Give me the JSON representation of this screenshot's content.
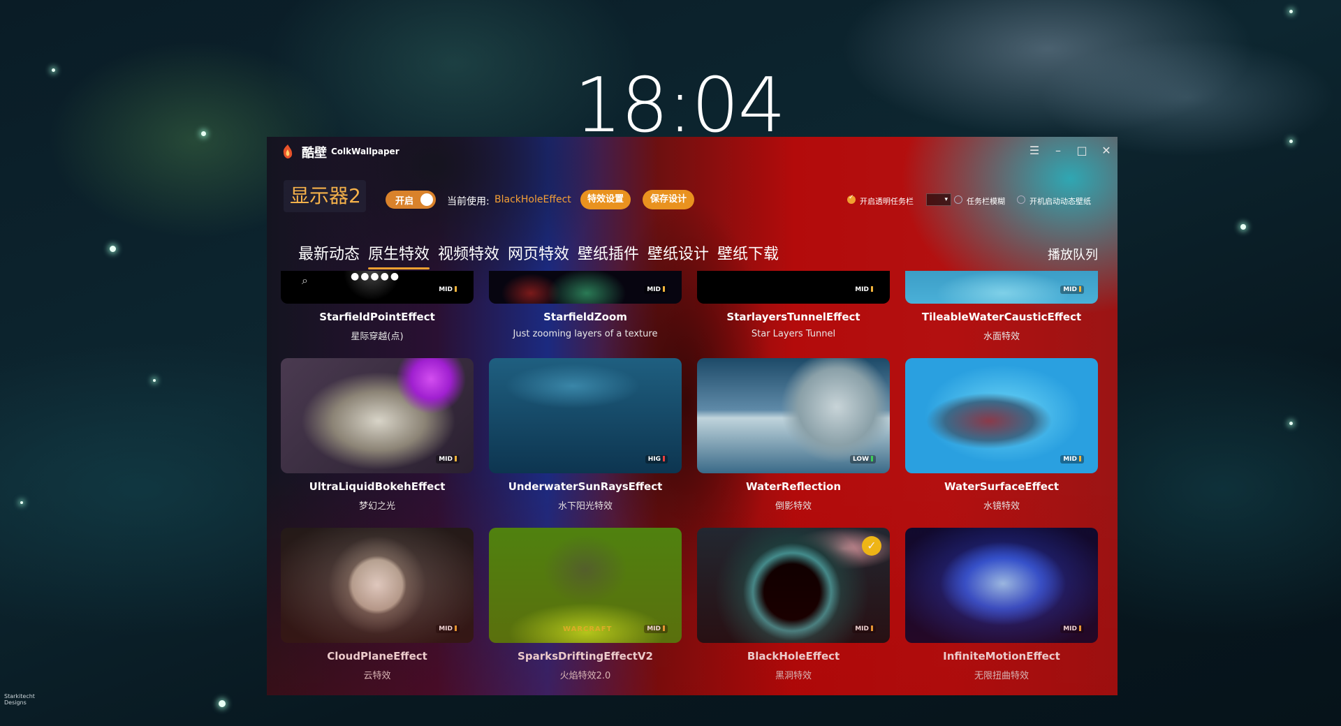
{
  "desktop": {
    "clock": "18:04",
    "corner_logo": [
      "Starkitecht",
      "Designs"
    ]
  },
  "app": {
    "title_cn": "酷壁",
    "title_en": "ColkWallpaper",
    "controls": {
      "menu": "☰",
      "minimize": "–",
      "maximize": "□",
      "close": "✕"
    }
  },
  "header": {
    "monitor": "显示器2",
    "toggle_label": "开启",
    "current_label": "当前使用:",
    "current_value": "BlackHoleEffect",
    "effect_settings": "特效设置",
    "save_design": "保存设计",
    "options": {
      "transparent_taskbar": "开启透明任务栏",
      "taskbar_blur": "任务栏模糊",
      "startup_dynamic": "开机启动动态壁纸"
    },
    "dropdown_symbol": "▾"
  },
  "tabs": [
    "最新动态",
    "原生特效",
    "视频特效",
    "网页特效",
    "壁纸插件",
    "壁纸设计",
    "壁纸下载"
  ],
  "active_tab": "原生特效",
  "play_queue": "播放队列",
  "cards": [
    {
      "title": "StarfieldPointEffect",
      "desc": "星际穿越(点)",
      "badge": "MID",
      "bar_color": "#f2b43c"
    },
    {
      "title": "StarfieldZoom",
      "desc": "Just zooming layers of a texture",
      "badge": "MID",
      "bar_color": "#f2b43c"
    },
    {
      "title": "StarlayersTunnelEffect",
      "desc": "Star Layers Tunnel",
      "badge": "MID",
      "bar_color": "#f2b43c"
    },
    {
      "title": "TileableWaterCausticEffect",
      "desc": "水面特效",
      "badge": "MID",
      "bar_color": "#f2b43c"
    },
    {
      "title": "UltraLiquidBokehEffect",
      "desc": "梦幻之光",
      "badge": "MID",
      "bar_color": "#f2b43c"
    },
    {
      "title": "UnderwaterSunRaysEffect",
      "desc": "水下阳光特效",
      "badge": "HIG",
      "bar_color": "#e84040"
    },
    {
      "title": "WaterReflection",
      "desc": "倒影特效",
      "badge": "LOW",
      "bar_color": "#3ecf5a"
    },
    {
      "title": "WaterSurfaceEffect",
      "desc": "水镜特效",
      "badge": "MID",
      "bar_color": "#f2b43c"
    },
    {
      "title": "CloudPlaneEffect",
      "desc": "云特效",
      "badge": "MID",
      "bar_color": "#f2b43c"
    },
    {
      "title": "SparksDriftingEffectV2",
      "desc": "火焰特效2.0",
      "badge": "MID",
      "bar_color": "#f2b43c"
    },
    {
      "title": "BlackHoleEffect",
      "desc": "黑洞特效",
      "badge": "MID",
      "bar_color": "#f2b43c",
      "selected": true
    },
    {
      "title": "InfiniteMotionEffect",
      "desc": "无限扭曲特效",
      "badge": "MID",
      "bar_color": "#f2b43c"
    }
  ],
  "thumbnail_text": {
    "warcraft": "WARCRAFT"
  }
}
